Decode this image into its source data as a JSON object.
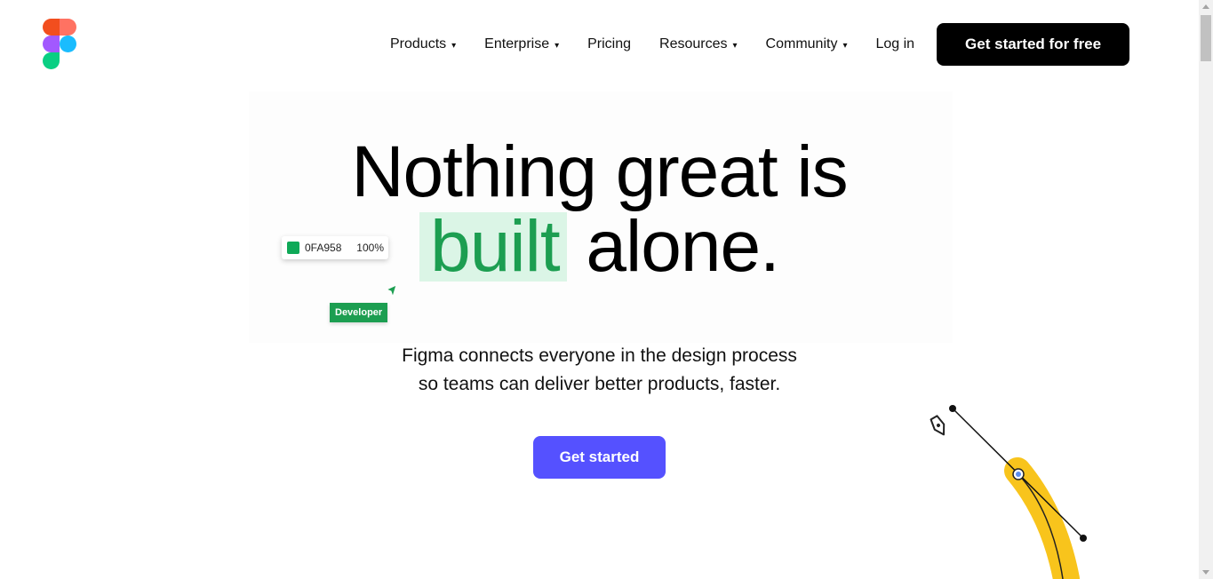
{
  "nav": {
    "items": [
      {
        "label": "Products",
        "has_dropdown": true
      },
      {
        "label": "Enterprise",
        "has_dropdown": true
      },
      {
        "label": "Pricing",
        "has_dropdown": false
      },
      {
        "label": "Resources",
        "has_dropdown": true
      },
      {
        "label": "Community",
        "has_dropdown": true
      },
      {
        "label": "Log in",
        "has_dropdown": false
      }
    ],
    "caret": "▾",
    "cta_label": "Get started for free"
  },
  "logo": {
    "icon": "figma-logo-icon",
    "colors": [
      "#f24e1e",
      "#ff7262",
      "#a259ff",
      "#1abcfe",
      "#0acf83"
    ]
  },
  "hero": {
    "headline_line1": "Nothing great is",
    "headline_highlight": "built",
    "headline_rest": "alone.",
    "swatch": {
      "hex": "0FA958",
      "opacity": "100%",
      "color": "#0fa958"
    },
    "cursor_label": "Developer",
    "subtitle_line1": "Figma connects everyone in the design process",
    "subtitle_line2": "so teams can deliver better products, faster.",
    "cta_label": "Get started"
  },
  "colors": {
    "accent": "#5551ff",
    "highlight_bg": "#dbf5e6",
    "highlight_text": "#1c9e51",
    "pen_stroke": "#f8c41c"
  }
}
